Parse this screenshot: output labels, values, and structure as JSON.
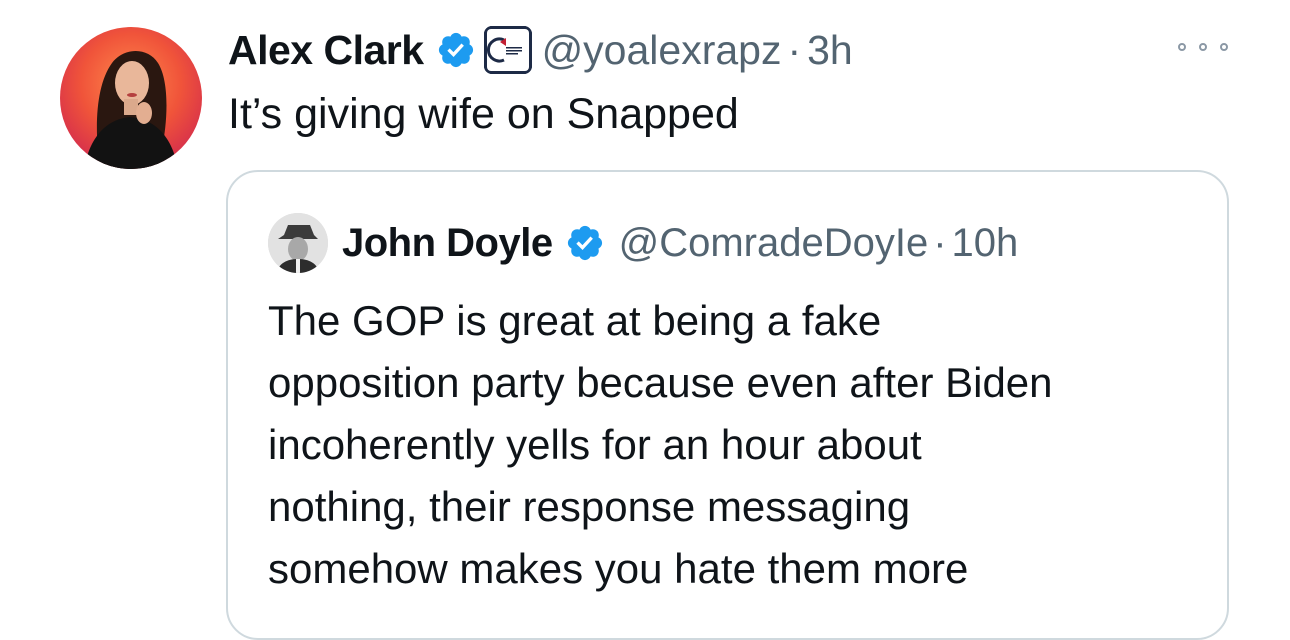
{
  "tweet": {
    "author": {
      "display_name": "Alex Clark",
      "handle": "@yoalexrapz",
      "verified": true,
      "affiliate_badge_icon": "turning-point-usa-badge-icon"
    },
    "separator": "·",
    "time": "3h",
    "text": "It’s giving wife on Snapped",
    "more_icon": "more-horizontal-icon"
  },
  "quoted_tweet": {
    "author": {
      "display_name": "John Doyle",
      "handle": "@ComradeDoyIe",
      "verified": true
    },
    "separator": "·",
    "time": "10h",
    "text": "The GOP is great at being a fake\nopposition party because even after Biden\nincoherently yells for an hour about\nnothing, their response messaging\nsomehow makes you hate them more"
  },
  "colors": {
    "verified_blue": "#1d9bf0",
    "secondary_text": "#536471",
    "primary_text": "#0f1419",
    "card_border": "#cfd9de"
  }
}
